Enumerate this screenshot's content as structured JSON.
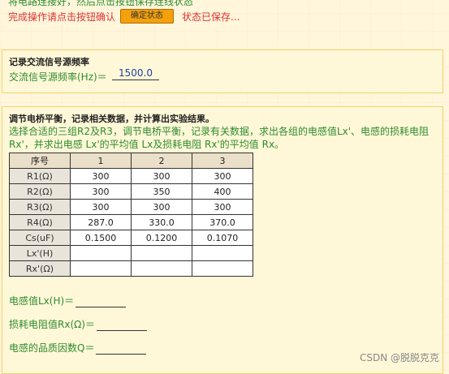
{
  "top": {
    "green_text": "将电路连接好，然后点击按钮保存连线状态",
    "red_text": "完成操作请点击按钮确认",
    "confirm_button": "确定状态",
    "status_text": "状态已保存..."
  },
  "section1": {
    "title": "记录交流信号源频率",
    "freq_label": "交流信号源频率(Hz)＝",
    "freq_value": "1500.0"
  },
  "section2": {
    "title": "调节电桥平衡，记录相关数据，并计算出实验结果。",
    "description": "选择合适的三组R2及R3，调节电桥平衡，记录有关数据，求出各组的电感值Lx'、电感的损耗电阻Rx'，并求出电感 Lx'的平均值 Lx及损耗电阻 Rx'的平均值 Rx。",
    "table": {
      "headers": [
        "序号",
        "1",
        "2",
        "3"
      ],
      "rows": [
        {
          "label": "R1(Ω)",
          "values": [
            "300",
            "300",
            "300"
          ]
        },
        {
          "label": "R2(Ω)",
          "values": [
            "300",
            "350",
            "400"
          ]
        },
        {
          "label": "R3(Ω)",
          "values": [
            "300",
            "300",
            "300"
          ]
        },
        {
          "label": "R4(Ω)",
          "values": [
            "287.0",
            "330.0",
            "370.0"
          ]
        },
        {
          "label": "Cs(uF)",
          "values": [
            "0.1500",
            "0.1200",
            "0.1070"
          ]
        },
        {
          "label": "Lx'(H)",
          "values": [
            "",
            "",
            ""
          ]
        },
        {
          "label": "Rx'(Ω)",
          "values": [
            "",
            "",
            ""
          ]
        }
      ]
    },
    "results": {
      "lx_label": "电感值Lx(H)＝",
      "rx_label": "损耗电阻值Rx(Ω)＝",
      "q_label": "电感的品质因数Q＝"
    }
  },
  "watermark": "CSDN @脱脱克克"
}
